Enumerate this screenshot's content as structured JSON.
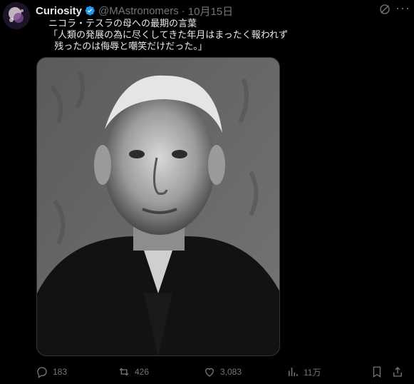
{
  "author": {
    "name": "Curiosity",
    "handle": "@MAstronomers",
    "separator": "·",
    "date": "10月15日",
    "verified_color": "#1d9bf0"
  },
  "tweet": {
    "lines": [
      "ニコラ・テスラの母への最期の言葉",
      "「人類の発展の為に尽くしてきた年月はまったく報われず",
      "  残ったのは侮辱と嘲笑だけだった。」"
    ]
  },
  "media": {
    "description_icon": "portrait-photo"
  },
  "metrics": {
    "replies": "183",
    "reposts": "426",
    "likes": "3,083",
    "views": "11万"
  },
  "colors": {
    "background": "#000000",
    "text": "#e7e9ea",
    "muted": "#71767b",
    "border": "#2f3336"
  }
}
